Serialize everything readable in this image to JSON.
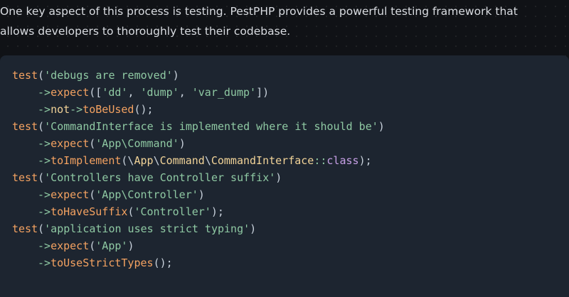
{
  "intro": {
    "line1": "One key aspect of this process is testing. PestPHP provides a powerful testing framework that",
    "line2": "allows developers to thoroughly test their codebase."
  },
  "code": {
    "lines": [
      {
        "tokens": [
          "test",
          "(",
          "'debugs are removed'",
          ")"
        ]
      },
      {
        "tokens": [
          "->",
          "expect",
          "([",
          "'dd'",
          ", ",
          "'dump'",
          ", ",
          "'var_dump'",
          "])"
        ]
      },
      {
        "tokens": [
          "->",
          "not",
          "->",
          "toBeUsed",
          "();"
        ]
      },
      {
        "tokens": [
          "test",
          "(",
          "'CommandInterface is implemented where it should be'",
          ")"
        ]
      },
      {
        "tokens": [
          "->",
          "expect",
          "(",
          "'App\\Command'",
          ")"
        ]
      },
      {
        "tokens": [
          "->",
          "toImplement",
          "(\\",
          "App",
          "\\",
          "Command",
          "\\",
          "CommandInterface",
          "::",
          "class",
          ");"
        ]
      },
      {
        "tokens": [
          "test",
          "(",
          "'Controllers have Controller suffix'",
          ")"
        ]
      },
      {
        "tokens": [
          "->",
          "expect",
          "(",
          "'App\\Controller'",
          ")"
        ]
      },
      {
        "tokens": [
          "->",
          "toHaveSuffix",
          "(",
          "'Controller'",
          ");"
        ]
      },
      {
        "tokens": [
          "test",
          "(",
          "'application uses strict typing'",
          ")"
        ]
      },
      {
        "tokens": [
          "->",
          "expect",
          "(",
          "'App'",
          ")"
        ]
      },
      {
        "tokens": [
          "->",
          "toUseStrictTypes",
          "();"
        ]
      }
    ]
  }
}
